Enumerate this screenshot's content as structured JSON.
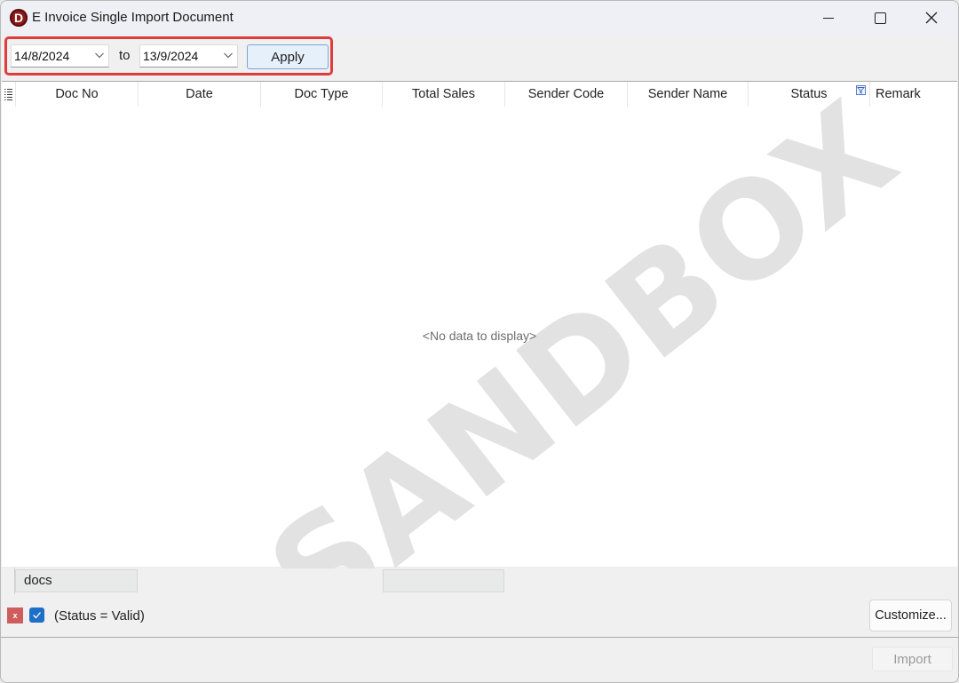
{
  "window": {
    "title": "E Invoice Single Import Document",
    "app_icon_letter": "D",
    "controls": [
      "minimize",
      "maximize",
      "close"
    ]
  },
  "toolbar": {
    "date_from": "14/8/2024",
    "to_label": "to",
    "date_to": "13/9/2024",
    "apply_label": "Apply",
    "highlight_color": "#e03c3c"
  },
  "grid": {
    "columns": [
      {
        "label": "Doc No"
      },
      {
        "label": "Date"
      },
      {
        "label": "Doc Type"
      },
      {
        "label": "Total Sales"
      },
      {
        "label": "Sender Code"
      },
      {
        "label": "Sender Name"
      },
      {
        "label": "Status",
        "filtered": true
      },
      {
        "label": "Remark"
      }
    ],
    "rows": [],
    "empty_text": "<No data to display>",
    "watermark": "SANDBOX",
    "footer": {
      "doc_no_summary": "docs",
      "total_sales_summary": ""
    }
  },
  "filter_bar": {
    "filter_text": "(Status = Valid)",
    "filter_enabled": true,
    "clear_label": "x",
    "customize_label": "Customize..."
  },
  "actions": {
    "import_label": "Import",
    "import_enabled": false
  }
}
